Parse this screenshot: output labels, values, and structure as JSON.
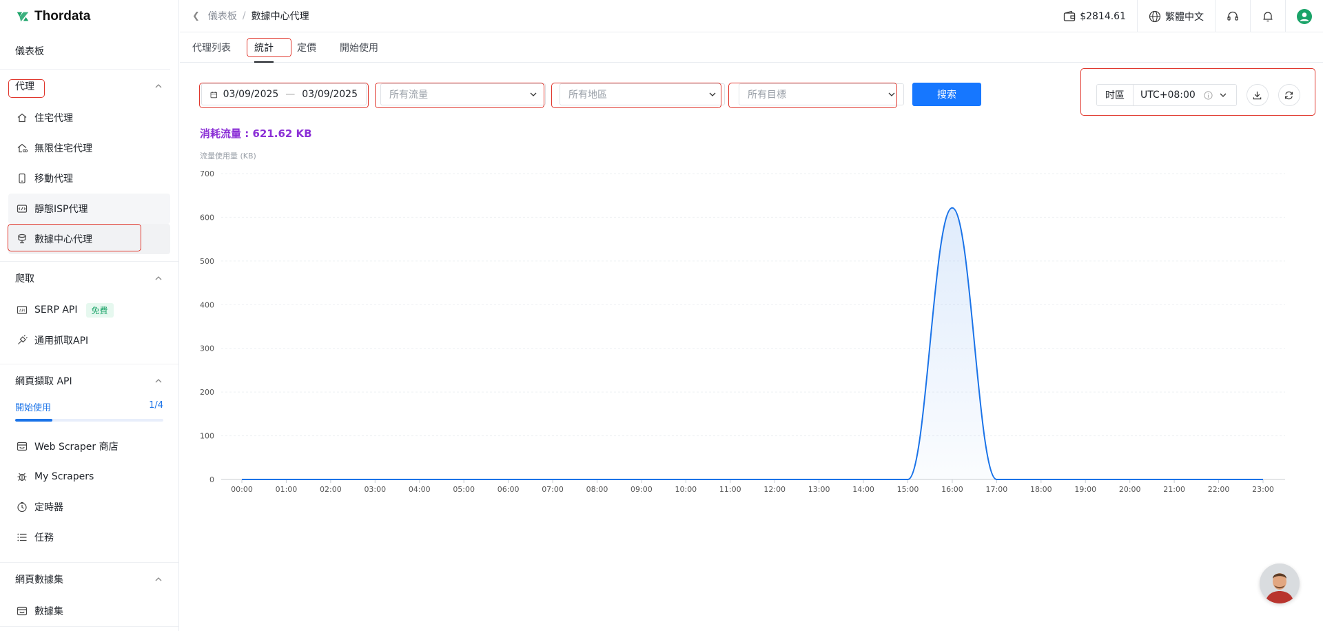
{
  "brand": {
    "name": "Thordata",
    "accent": "#1aa368"
  },
  "sidebar": {
    "dashboard": "儀表板",
    "proxy": {
      "title": "代理",
      "items": [
        {
          "label": "住宅代理",
          "icon": "home-icon"
        },
        {
          "label": "無限住宅代理",
          "icon": "home-infinity-icon"
        },
        {
          "label": "移動代理",
          "icon": "phone-icon"
        },
        {
          "label": "靜態ISP代理",
          "icon": "isp-icon"
        },
        {
          "label": "數據中心代理",
          "icon": "database-icon"
        }
      ]
    },
    "scrape": {
      "title": "爬取",
      "items": [
        {
          "label": "SERP API",
          "icon": "api-icon",
          "badge": "免費"
        },
        {
          "label": "通用抓取API",
          "icon": "plug-icon"
        }
      ]
    },
    "webapi": {
      "title": "網頁擷取 API",
      "progress_label": "開始使用",
      "progress_value": "1/4",
      "progress_fraction": 0.25,
      "items": [
        {
          "label": "Web Scraper 商店",
          "icon": "store-icon"
        },
        {
          "label": "My Scrapers",
          "icon": "bug-icon"
        },
        {
          "label": "定時器",
          "icon": "clock-icon"
        },
        {
          "label": "任務",
          "icon": "list-icon"
        }
      ]
    },
    "dataset": {
      "title": "網頁數據集",
      "items": [
        {
          "label": "數據集",
          "icon": "dataset-icon"
        }
      ]
    }
  },
  "topbar": {
    "breadcrumb": [
      "儀表板",
      "/",
      "數據中心代理"
    ],
    "balance": "$2814.61",
    "language": "繁體中文"
  },
  "tabs": [
    "代理列表",
    "統計",
    "定價",
    "開始使用"
  ],
  "filters": {
    "date_start": "03/09/2025",
    "date_sep": "—",
    "date_end": "03/09/2025",
    "traffic_placeholder": "所有流量",
    "region_placeholder": "所有地區",
    "target_placeholder": "所有目標",
    "search_label": "搜索",
    "timezone_label": "时區",
    "timezone_value": "UTC+08:00"
  },
  "usage_total": "消耗流量 : 621.62 KB",
  "chart_data": {
    "type": "area",
    "ylabel": "流量使用量 (KB)",
    "ylim": [
      0,
      700
    ],
    "yticks": [
      0,
      100,
      200,
      300,
      400,
      500,
      600,
      700
    ],
    "x": [
      "00:00",
      "01:00",
      "02:00",
      "03:00",
      "04:00",
      "05:00",
      "06:00",
      "07:00",
      "08:00",
      "09:00",
      "10:00",
      "11:00",
      "12:00",
      "13:00",
      "14:00",
      "15:00",
      "16:00",
      "17:00",
      "18:00",
      "19:00",
      "20:00",
      "21:00",
      "22:00",
      "23:00"
    ],
    "values": [
      0,
      0,
      0,
      0,
      0,
      0,
      0,
      0,
      0,
      0,
      0,
      0,
      0,
      0,
      0,
      0,
      621.62,
      0,
      0,
      0,
      0,
      0,
      0,
      0
    ],
    "color": "#1a73e8"
  }
}
